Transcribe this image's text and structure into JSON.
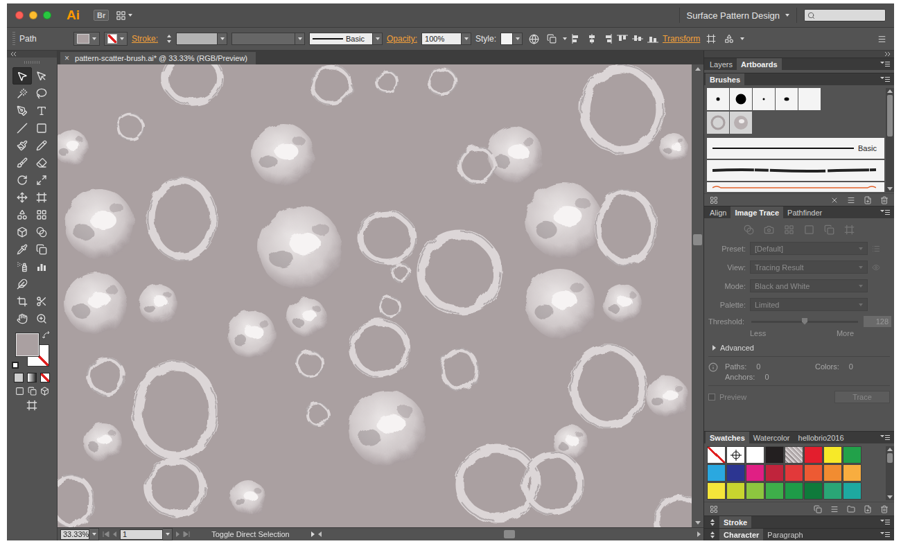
{
  "window": {
    "logo": "Ai",
    "bridge": "Br",
    "workspace": "Surface Pattern Design"
  },
  "control_bar": {
    "object_type": "Path",
    "fill_color": "#aaa0a1",
    "stroke_none": true,
    "stroke_label": "Stroke:",
    "brush": "Basic",
    "opacity_label": "Opacity:",
    "opacity": "100%",
    "style_label": "Style:",
    "transform_label": "Transform"
  },
  "toolbar": {
    "fill_color": "#aaa0a1",
    "stroke_none": true,
    "tools": [
      {
        "selected": true
      },
      {
        "selected": false
      },
      {
        "selected": false
      },
      {
        "selected": false
      },
      {
        "selected": false
      },
      {
        "selected": false
      },
      {
        "selected": false
      },
      {
        "selected": false
      },
      {
        "selected": false
      },
      {
        "selected": false
      },
      {
        "selected": false
      },
      {
        "selected": false
      },
      {
        "selected": false
      },
      {
        "selected": false
      },
      {
        "selected": false
      },
      {
        "selected": false
      },
      {
        "selected": false
      },
      {
        "selected": false
      },
      {
        "selected": false
      },
      {
        "selected": false
      },
      {
        "selected": false
      },
      {
        "selected": false
      },
      {
        "selected": false
      },
      {
        "selected": false
      },
      {
        "selected": false
      },
      {
        "selected": false
      },
      {
        "selected": false
      },
      {
        "selected": false
      },
      {
        "selected": false
      }
    ]
  },
  "document": {
    "close": "×",
    "title": "pattern-scatter-brush.ai* @ 33.33% (RGB/Preview)"
  },
  "status_bar": {
    "zoom": "33.33%",
    "artboard": "1",
    "message": "Toggle Direct Selection"
  },
  "top_tabs": [
    {
      "label": "Layers",
      "selected": false
    },
    {
      "label": "Artboards",
      "selected": true
    }
  ],
  "brushes": {
    "tabs": [
      {
        "label": "Brushes",
        "selected": true
      }
    ],
    "basic_label": "Basic"
  },
  "trace_tabs": [
    {
      "label": "Align",
      "selected": false
    },
    {
      "label": "Image Trace",
      "selected": true
    },
    {
      "label": "Pathfinder",
      "selected": false
    }
  ],
  "image_trace": {
    "disabled": true,
    "fields": [
      {
        "label": "Preset:",
        "value": "[Default]"
      },
      {
        "label": "View:",
        "value": "Tracing Result"
      },
      {
        "label": "Mode:",
        "value": "Black and White"
      },
      {
        "label": "Palette:",
        "value": "Limited"
      }
    ],
    "threshold": {
      "label": "Threshold:",
      "value": "128",
      "level": 0.5,
      "less": "Less",
      "more": "More"
    },
    "advanced": {
      "label": "Advanced",
      "expanded": false
    },
    "stats": [
      {
        "label": "Paths:",
        "value": "0"
      },
      {
        "label": "Colors:",
        "value": "0"
      },
      {
        "label": "Anchors:",
        "value": "0"
      }
    ],
    "preview": {
      "label": "Preview",
      "checked": false
    },
    "trace_button": "Trace"
  },
  "swatch_tabs": [
    {
      "label": "Swatches",
      "selected": true
    },
    {
      "label": "Watercolor",
      "selected": false
    },
    {
      "label": "hellobrio2016",
      "selected": false
    }
  ],
  "swatches": [
    {
      "kind": "none",
      "color": "#ffffff"
    },
    {
      "kind": "registration",
      "color": "#ffffff"
    },
    {
      "kind": "color",
      "color": "#ffffff"
    },
    {
      "kind": "color",
      "color": "#231f20"
    },
    {
      "kind": "pattern",
      "color": "#b9b1b2"
    },
    {
      "kind": "color",
      "color": "#e31e2d"
    },
    {
      "kind": "color",
      "color": "#f7e928"
    },
    {
      "kind": "color",
      "color": "#22a14a"
    },
    {
      "kind": "color",
      "color": "#2aa8e0"
    },
    {
      "kind": "color",
      "color": "#2c3591"
    },
    {
      "kind": "color",
      "color": "#e01f84"
    },
    {
      "kind": "color",
      "color": "#c0243c"
    },
    {
      "kind": "color",
      "color": "#e2393a"
    },
    {
      "kind": "color",
      "color": "#ed5a33"
    },
    {
      "kind": "color",
      "color": "#f18c31"
    },
    {
      "kind": "color",
      "color": "#f8ad3f"
    },
    {
      "kind": "color",
      "color": "#f4e53a"
    },
    {
      "kind": "color",
      "color": "#c8d52f"
    },
    {
      "kind": "color",
      "color": "#8dc63f"
    },
    {
      "kind": "color",
      "color": "#3eaf4a"
    },
    {
      "kind": "color",
      "color": "#1e9b48"
    },
    {
      "kind": "color",
      "color": "#0f7a3b"
    },
    {
      "kind": "color",
      "color": "#2aa676"
    },
    {
      "kind": "color",
      "color": "#1ea9a0"
    }
  ],
  "stroke_panel": {
    "tabs": [
      {
        "label": "Stroke",
        "selected": true
      }
    ]
  },
  "character_panel": {
    "tabs": [
      {
        "label": "Character",
        "selected": true
      },
      {
        "label": "Paragraph",
        "selected": false
      }
    ]
  }
}
